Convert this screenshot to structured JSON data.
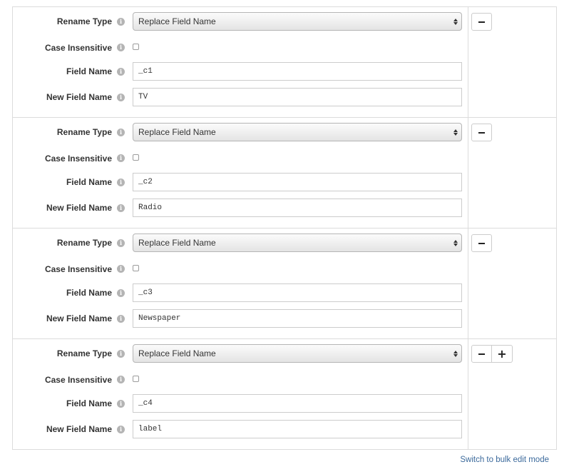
{
  "labels": {
    "rename_type": "Rename Type",
    "case_insensitive": "Case Insensitive",
    "field_name": "Field Name",
    "new_field_name": "New Field Name",
    "info_glyph": "i"
  },
  "icons": {
    "remove": "minus-icon",
    "add": "plus-icon",
    "info": "info-icon",
    "select_arrows": "select-arrows-icon"
  },
  "buttons": {
    "add_glyph": "+"
  },
  "rows": [
    {
      "rename_type": "Replace Field Name",
      "case_insensitive": false,
      "field_name": "_c1",
      "new_field_name": "TV"
    },
    {
      "rename_type": "Replace Field Name",
      "case_insensitive": false,
      "field_name": "_c2",
      "new_field_name": "Radio"
    },
    {
      "rename_type": "Replace Field Name",
      "case_insensitive": false,
      "field_name": "_c3",
      "new_field_name": "Newspaper"
    },
    {
      "rename_type": "Replace Field Name",
      "case_insensitive": false,
      "field_name": "_c4",
      "new_field_name": "label"
    }
  ],
  "footer": {
    "bulk_edit_link": "Switch to bulk edit mode"
  },
  "colors": {
    "link": "#3c6a9c",
    "border": "#dcdcdc",
    "label_text": "#333333",
    "info_icon": "#b4b4b4"
  }
}
